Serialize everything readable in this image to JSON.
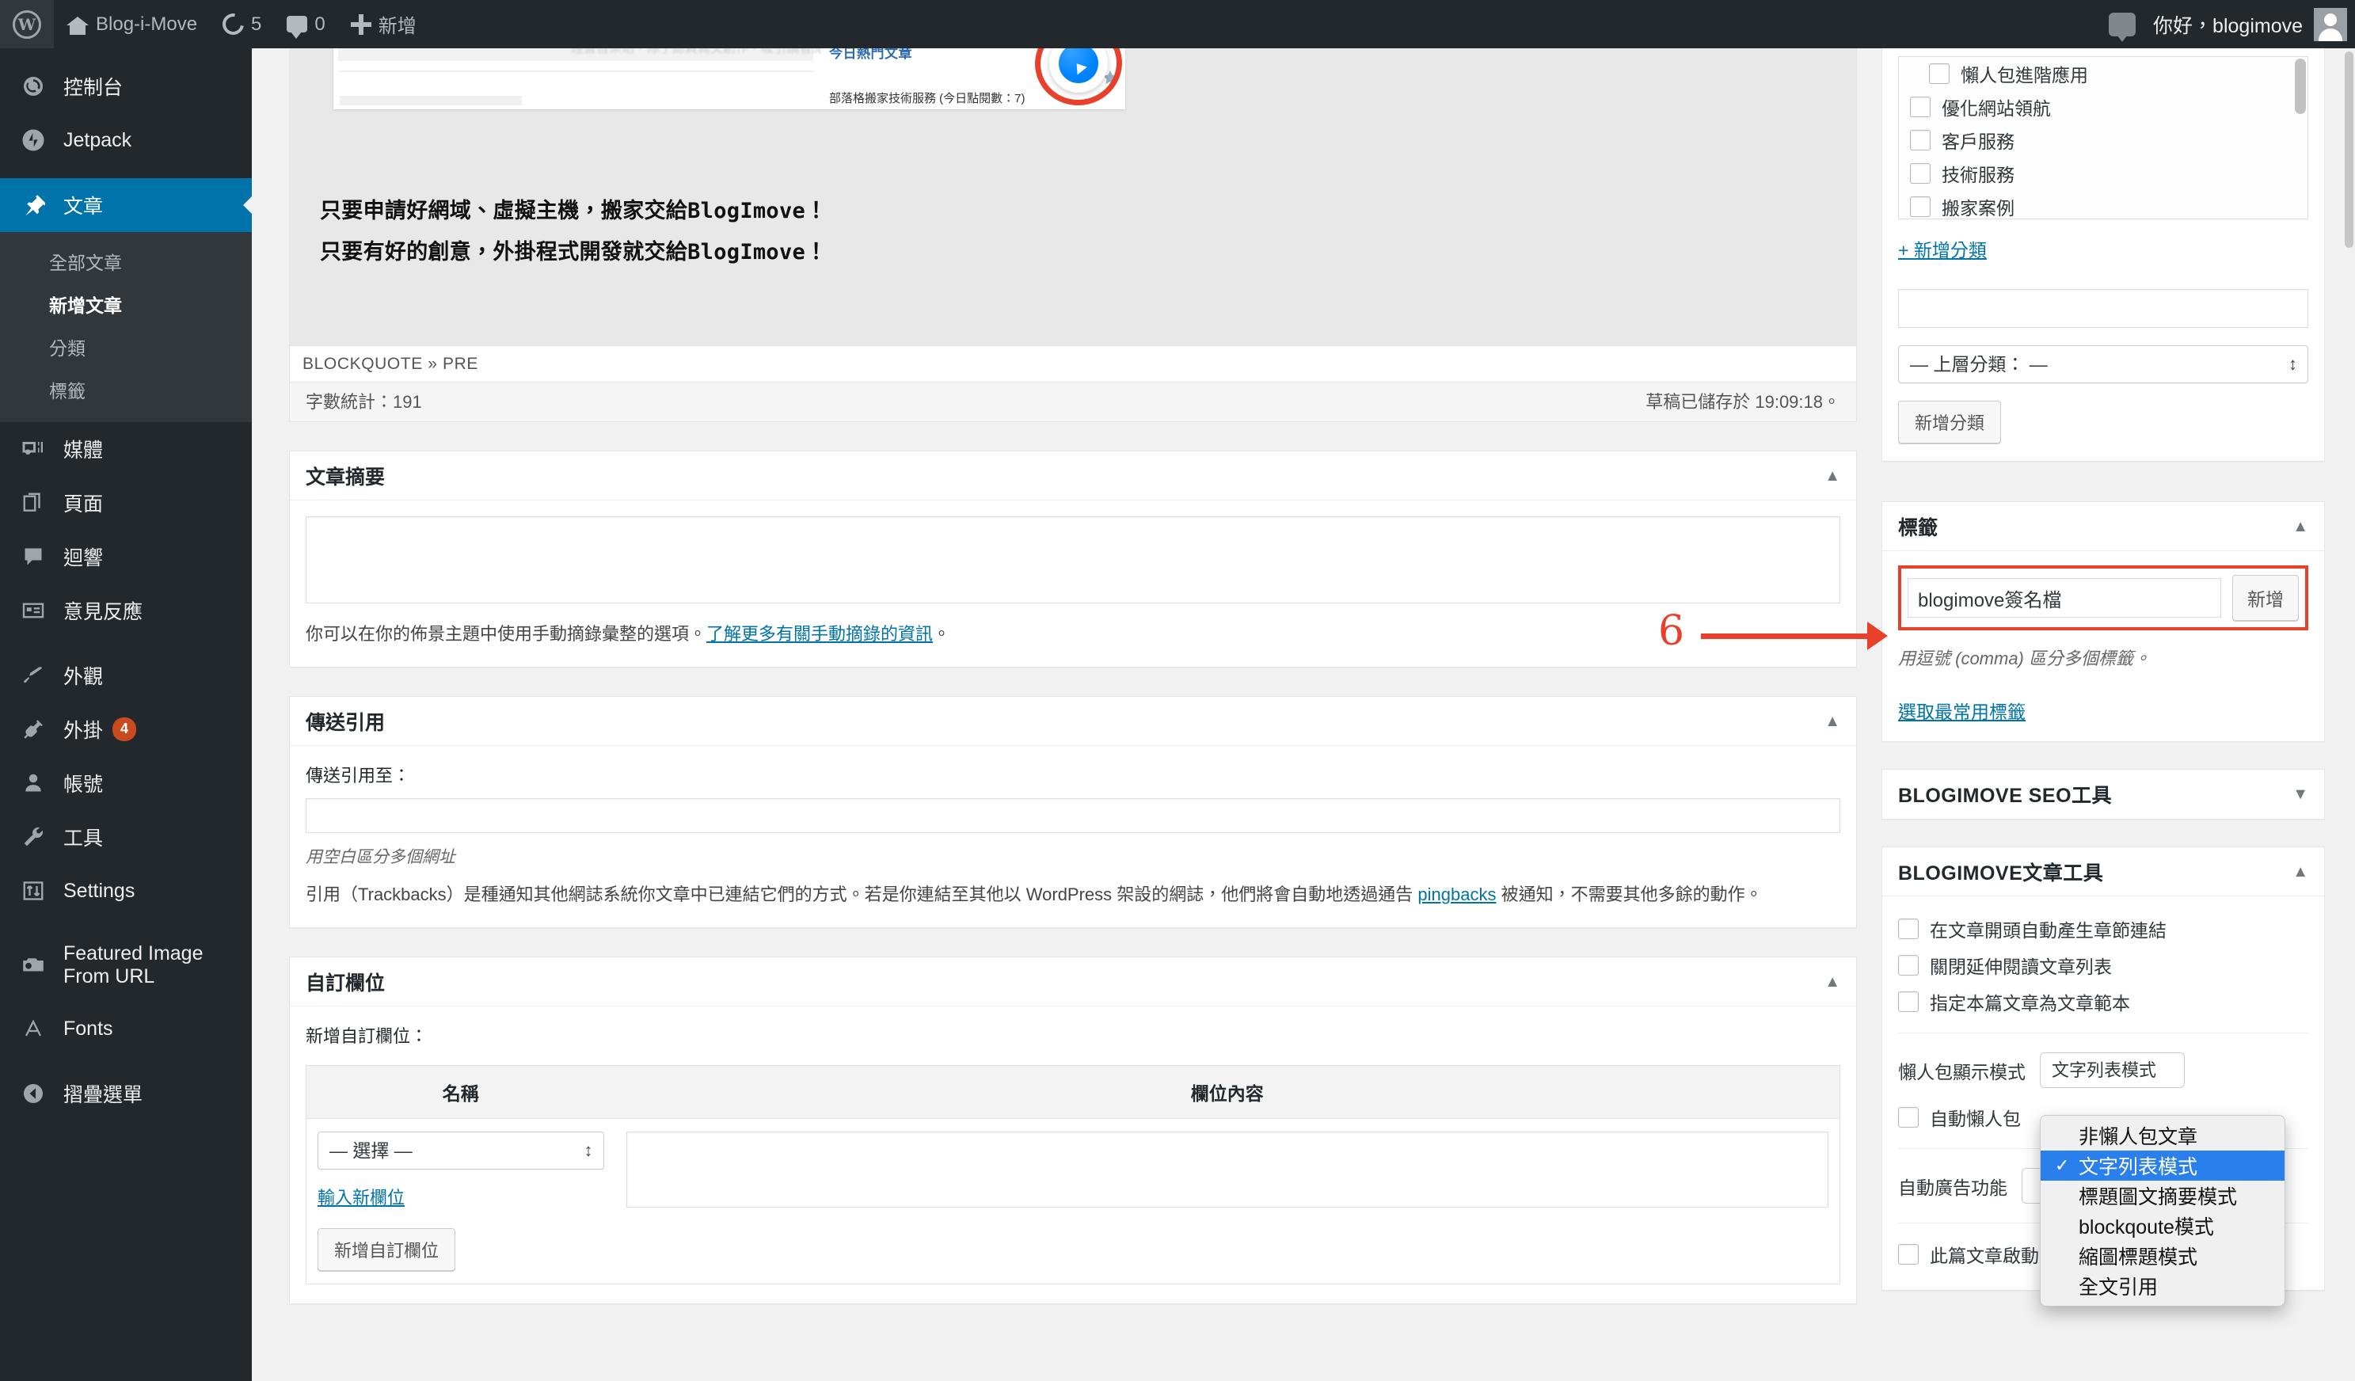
{
  "adminbar": {
    "site_name": "Blog-i-Move",
    "updates_count": "5",
    "comments_count": "0",
    "new_label": "新增",
    "howdy": "你好，blogimove",
    "icons": {
      "wp_logo": "wordpress-logo-icon",
      "home": "house-icon",
      "updates": "refresh-icon",
      "comments": "comment-bubble-icon",
      "new": "plus-icon",
      "notifications": "comment-bubble-icon",
      "avatar": "user-avatar-icon"
    }
  },
  "sidebar": {
    "items": [
      {
        "label": "控制台",
        "icon": "dashboard-icon"
      },
      {
        "label": "Jetpack",
        "icon": "jetpack-icon"
      },
      {
        "label": "文章",
        "icon": "pin-icon",
        "current": true
      },
      {
        "label": "媒體",
        "icon": "media-icon"
      },
      {
        "label": "頁面",
        "icon": "pages-icon"
      },
      {
        "label": "迴響",
        "icon": "comments-icon"
      },
      {
        "label": "意見反應",
        "icon": "feedback-icon"
      },
      {
        "label": "外觀",
        "icon": "appearance-brush-icon"
      },
      {
        "label": "外掛",
        "icon": "plugin-icon",
        "badge": "4"
      },
      {
        "label": "帳號",
        "icon": "users-icon"
      },
      {
        "label": "工具",
        "icon": "wrench-icon"
      },
      {
        "label": "Settings",
        "icon": "settings-sliders-icon"
      },
      {
        "label": "Featured Image From URL",
        "icon": "camera-icon"
      },
      {
        "label": "Fonts",
        "icon": "letter-a-icon"
      },
      {
        "label": "摺疊選單",
        "icon": "collapse-arrow-icon"
      }
    ],
    "posts_submenu": [
      {
        "label": "全部文章",
        "current": false
      },
      {
        "label": "新增文章",
        "current": true
      },
      {
        "label": "分類",
        "current": false
      },
      {
        "label": "標籤",
        "current": false
      }
    ]
  },
  "editor": {
    "embed_preview": {
      "blurred_text": "經營自架站，除了認真寫文創作，吸引讀者閱讀，還能…",
      "hot_posts_title": "今日熱門文章",
      "hot_posts_item": "部落格搬家技術服務 (今日點閱數：7)",
      "messenger_icon": "facebook-messenger-icon"
    },
    "body_line1": "只要申請好網域、虛擬主機，搬家交給BlogImove！",
    "body_line2": "只要有好的創意，外掛程式開發就交給BlogImove！",
    "path_bar": "BLOCKQUOTE » PRE",
    "word_count": "字數統計：191",
    "autosave_status": "草稿已儲存於 19:09:18。"
  },
  "excerpt_box": {
    "title": "文章摘要",
    "value": "",
    "help_prefix": "你可以在你的佈景主題中使用手動摘錄彙整的選項。",
    "help_link": "了解更多有關手動摘錄的資訊",
    "help_suffix": "。"
  },
  "trackback_box": {
    "title": "傳送引用",
    "field_label": "傳送引用至：",
    "value": "",
    "hint": "用空白區分多個網址",
    "paragraph_1": "引用（Trackbacks）是種通知其他網誌系統你文章中已連結它們的方式。若是你連結至其他以 WordPress 架設的網誌，他們將會自動地透過通告 ",
    "paragraph_link": "pingbacks",
    "paragraph_2": " 被通知，不需要其他多餘的動作。"
  },
  "custom_fields_box": {
    "title": "自訂欄位",
    "add_label": "新增自訂欄位：",
    "columns": [
      "名稱",
      "欄位內容"
    ],
    "select_value": "— 選擇 —",
    "enter_new_link": "輸入新欄位",
    "add_button": "新增自訂欄位",
    "value": ""
  },
  "categories_box": {
    "items": [
      {
        "label": "懶人包進階應用",
        "checked": false,
        "indent": true
      },
      {
        "label": "優化網站領航",
        "checked": false,
        "indent": false
      },
      {
        "label": "客戶服務",
        "checked": false,
        "indent": false
      },
      {
        "label": "技術服務",
        "checked": false,
        "indent": false
      },
      {
        "label": "搬家案例",
        "checked": false,
        "indent": false
      }
    ],
    "add_new_link": "+ 新增分類",
    "new_name_value": "",
    "parent_select_value": "— 上層分類： —",
    "add_button": "新增分類"
  },
  "tags_box": {
    "title": "標籤",
    "input_value": "blogimove簽名檔",
    "add_button": "新增",
    "hint": "用逗號 (comma) 區分多個標籤。",
    "choose_link": "選取最常用標籤"
  },
  "seo_box": {
    "title": "BLOGIMOVE SEO工具",
    "collapsed": true
  },
  "post_tools_box": {
    "title": "BLOGIMOVE文章工具",
    "checkboxes_top": [
      {
        "label": "在文章開頭自動產生章節連結",
        "checked": false
      },
      {
        "label": "關閉延伸閱讀文章列表",
        "checked": false
      },
      {
        "label": "指定本篇文章為文章範本",
        "checked": false
      }
    ],
    "display_mode_label": "懶人包顯示模式",
    "auto_lazy_label": "自動懶人包",
    "auto_ad_label": "自動廣告功能",
    "nl2br_label": "此篇文章啟動NL2BR功能"
  },
  "dropdown": {
    "options": [
      {
        "label": "非懶人包文章",
        "selected": false
      },
      {
        "label": "文字列表模式",
        "selected": true
      },
      {
        "label": "標題圖文摘要模式",
        "selected": false
      },
      {
        "label": "blockqoute模式",
        "selected": false
      },
      {
        "label": "縮圖標題模式",
        "selected": false
      },
      {
        "label": "全文引用",
        "selected": false
      }
    ]
  },
  "annotations": {
    "step_number": "6"
  },
  "colors": {
    "admin_dark": "#23282d",
    "admin_blue": "#0073aa",
    "annotation_red": "#e8412b",
    "link_blue": "#0073aa",
    "badge_orange": "#ca4a1f",
    "dropdown_highlight": "#2a7fec"
  }
}
